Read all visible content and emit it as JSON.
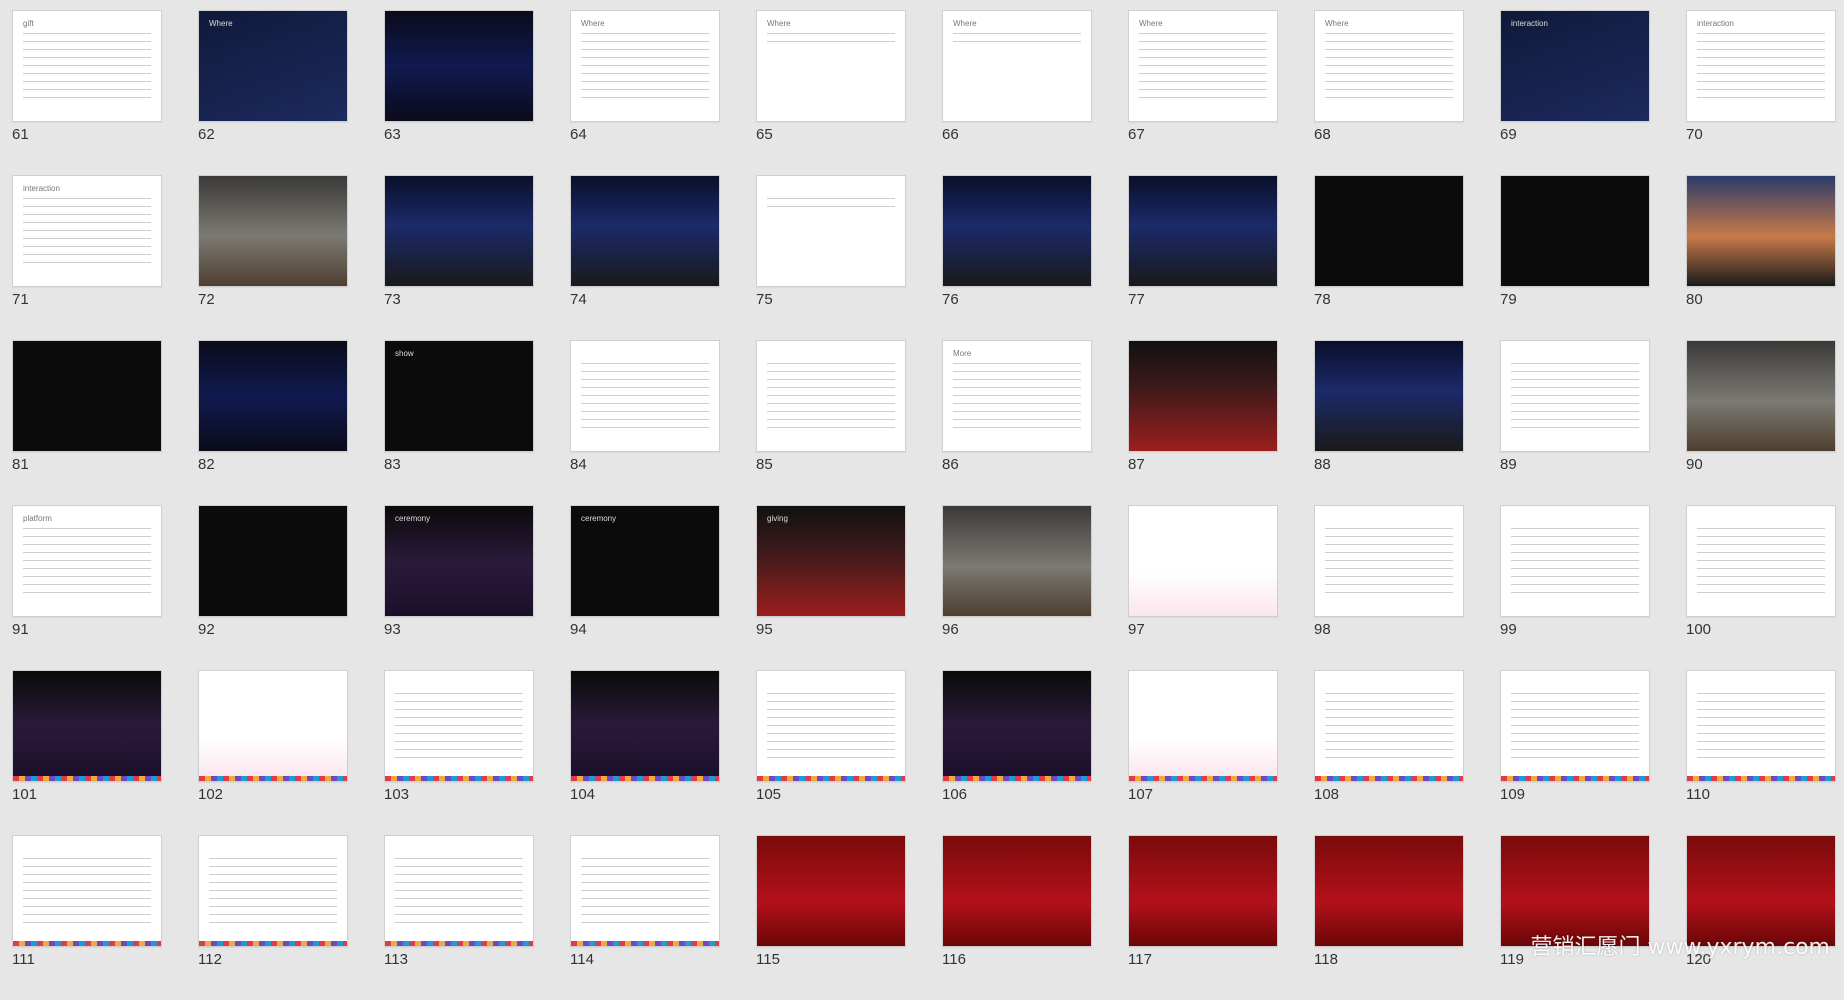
{
  "slides": [
    {
      "n": "61",
      "style": "white",
      "title": "gift"
    },
    {
      "n": "62",
      "style": "navy",
      "title": "Where"
    },
    {
      "n": "63",
      "style": "neon",
      "title": ""
    },
    {
      "n": "64",
      "style": "white",
      "title": "Where"
    },
    {
      "n": "65",
      "style": "white-redbar",
      "title": "Where"
    },
    {
      "n": "66",
      "style": "white-redbar",
      "title": "Where"
    },
    {
      "n": "67",
      "style": "white",
      "title": "Where"
    },
    {
      "n": "68",
      "style": "white",
      "title": "Where"
    },
    {
      "n": "69",
      "style": "navy",
      "title": "interaction"
    },
    {
      "n": "70",
      "style": "white",
      "title": "interaction"
    },
    {
      "n": "71",
      "style": "white",
      "title": "interaction"
    },
    {
      "n": "72",
      "style": "flower",
      "title": ""
    },
    {
      "n": "73",
      "style": "stage",
      "title": ""
    },
    {
      "n": "74",
      "style": "stage",
      "title": ""
    },
    {
      "n": "75",
      "style": "white-redbar",
      "title": ""
    },
    {
      "n": "76",
      "style": "stage",
      "title": ""
    },
    {
      "n": "77",
      "style": "stage",
      "title": ""
    },
    {
      "n": "78",
      "style": "black",
      "title": ""
    },
    {
      "n": "79",
      "style": "black",
      "title": ""
    },
    {
      "n": "80",
      "style": "city",
      "title": ""
    },
    {
      "n": "81",
      "style": "black",
      "title": ""
    },
    {
      "n": "82",
      "style": "neon",
      "title": ""
    },
    {
      "n": "83",
      "style": "black",
      "title": "show"
    },
    {
      "n": "84",
      "style": "table",
      "title": ""
    },
    {
      "n": "85",
      "style": "table",
      "title": ""
    },
    {
      "n": "86",
      "style": "white",
      "title": "More"
    },
    {
      "n": "87",
      "style": "photo-red",
      "title": ""
    },
    {
      "n": "88",
      "style": "stage",
      "title": ""
    },
    {
      "n": "89",
      "style": "table",
      "title": ""
    },
    {
      "n": "90",
      "style": "flower",
      "title": ""
    },
    {
      "n": "91",
      "style": "white",
      "title": "platform"
    },
    {
      "n": "92",
      "style": "black",
      "title": ""
    },
    {
      "n": "93",
      "style": "concert",
      "title": "ceremony"
    },
    {
      "n": "94",
      "style": "black",
      "title": "ceremony"
    },
    {
      "n": "95",
      "style": "photo-red",
      "title": "giving"
    },
    {
      "n": "96",
      "style": "flower",
      "title": ""
    },
    {
      "n": "97",
      "style": "pink",
      "title": ""
    },
    {
      "n": "98",
      "style": "white",
      "title": ""
    },
    {
      "n": "99",
      "style": "white",
      "title": ""
    },
    {
      "n": "100",
      "style": "white",
      "title": ""
    },
    {
      "n": "101",
      "style": "concert",
      "title": ""
    },
    {
      "n": "102",
      "style": "pink",
      "title": ""
    },
    {
      "n": "103",
      "style": "white",
      "title": ""
    },
    {
      "n": "104",
      "style": "concert",
      "title": ""
    },
    {
      "n": "105",
      "style": "white",
      "title": ""
    },
    {
      "n": "106",
      "style": "concert",
      "title": ""
    },
    {
      "n": "107",
      "style": "pink",
      "title": ""
    },
    {
      "n": "108",
      "style": "white",
      "title": ""
    },
    {
      "n": "109",
      "style": "white",
      "title": ""
    },
    {
      "n": "110",
      "style": "white",
      "title": ""
    },
    {
      "n": "111",
      "style": "white",
      "title": ""
    },
    {
      "n": "112",
      "style": "white",
      "title": ""
    },
    {
      "n": "113",
      "style": "white",
      "title": ""
    },
    {
      "n": "114",
      "style": "white",
      "title": ""
    },
    {
      "n": "115",
      "style": "red",
      "title": ""
    },
    {
      "n": "116",
      "style": "red",
      "title": ""
    },
    {
      "n": "117",
      "style": "red",
      "title": ""
    },
    {
      "n": "118",
      "style": "red",
      "title": ""
    },
    {
      "n": "119",
      "style": "red",
      "title": ""
    },
    {
      "n": "120",
      "style": "red",
      "title": ""
    }
  ],
  "watermark": "营销汇愿门 www.yxrym.com"
}
